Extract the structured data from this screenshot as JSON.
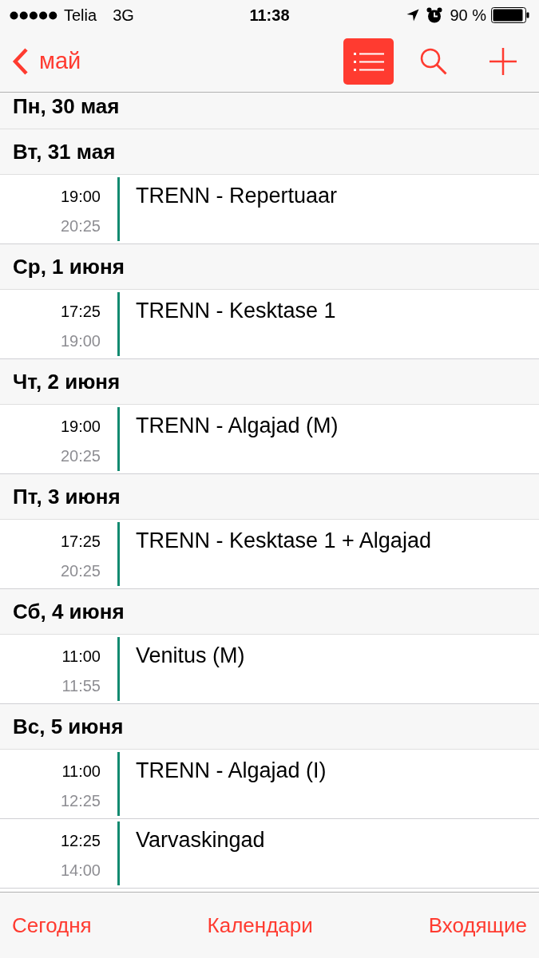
{
  "status_bar": {
    "carrier": "Telia",
    "network": "3G",
    "time": "11:38",
    "battery": "90 %"
  },
  "nav": {
    "back": "май",
    "list_selected": true
  },
  "days": [
    {
      "label": "Пн, 30 мая"
    },
    {
      "label": "Вт, 31 мая",
      "events": [
        {
          "start": "19:00",
          "end": "20:25",
          "title": "TRENN - Repertuaar"
        }
      ]
    },
    {
      "label": "Ср, 1 июня",
      "events": [
        {
          "start": "17:25",
          "end": "19:00",
          "title": "TRENN - Kesktase 1"
        }
      ]
    },
    {
      "label": "Чт, 2 июня",
      "events": [
        {
          "start": "19:00",
          "end": "20:25",
          "title": "TRENN - Algajad (M)"
        }
      ]
    },
    {
      "label": "Пт, 3 июня",
      "events": [
        {
          "start": "17:25",
          "end": "20:25",
          "title": "TRENN - Kesktase 1 + Algajad"
        }
      ]
    },
    {
      "label": "Сб, 4 июня",
      "events": [
        {
          "start": "11:00",
          "end": "11:55",
          "title": "Venitus (M)"
        }
      ]
    },
    {
      "label": "Вс, 5 июня",
      "events": [
        {
          "start": "11:00",
          "end": "12:25",
          "title": "TRENN - Algajad (I)"
        },
        {
          "start": "12:25",
          "end": "14:00",
          "title": "Varvaskingad"
        }
      ]
    }
  ],
  "tab_bar": [
    "Сегодня",
    "Календари",
    "Входящие"
  ]
}
